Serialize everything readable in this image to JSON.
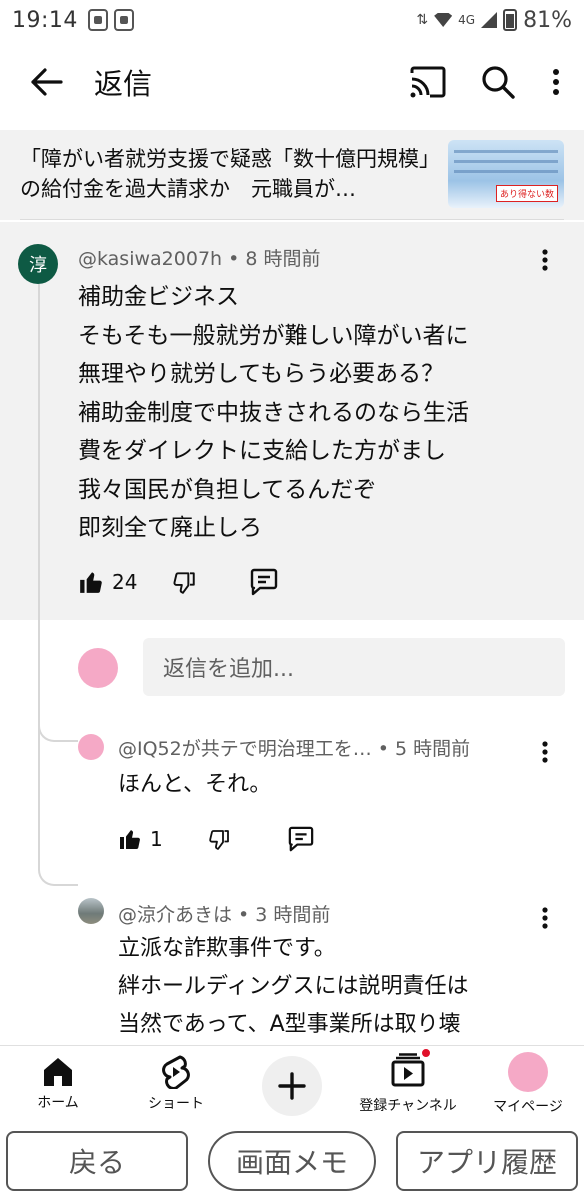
{
  "status": {
    "time": "19:14",
    "network": "4G",
    "battery": "81%"
  },
  "header": {
    "title": "返信"
  },
  "context": {
    "title": "「障がい者就労支援で疑惑「数十億円規模」の給付金を過大請求か　元職員が…",
    "thumb_tag": "あり得ない数"
  },
  "comment": {
    "avatar_text": "淳",
    "meta": "@kasiwa2007h • 8 時間前",
    "lines": [
      "補助金ビジネス",
      "そもそも一般就労が難しい障がい者に",
      "無理やり就労してもらう必要ある？",
      "補助金制度で中抜きされるのなら生活",
      "費をダイレクトに支給した方がまし",
      "我々国民が負担してるんだぞ",
      "即刻全て廃止しろ"
    ],
    "likes": "24"
  },
  "reply_input": {
    "placeholder": "返信を追加..."
  },
  "replies": [
    {
      "meta": "@IQ52が共テで明治理工を… • 5 時間前",
      "lines": [
        "ほんと、それ。"
      ],
      "likes": "1"
    },
    {
      "meta": "@涼介あきは • 3 時間前",
      "lines": [
        "立派な詐欺事件です。",
        "絆ホールディングスには説明責任は",
        "当然であって、A型事業所は取り壊"
      ]
    }
  ],
  "nav": {
    "home": "ホーム",
    "shorts": "ショート",
    "subscriptions": "登録チャンネル",
    "mypage": "マイページ"
  },
  "system": {
    "back": "戻る",
    "memo": "画面メモ",
    "history": "アプリ履歴"
  },
  "colors": {
    "accent_red": "#e0102a",
    "avatar_green": "#0e5a44",
    "avatar_pink": "#f5a9c6"
  }
}
